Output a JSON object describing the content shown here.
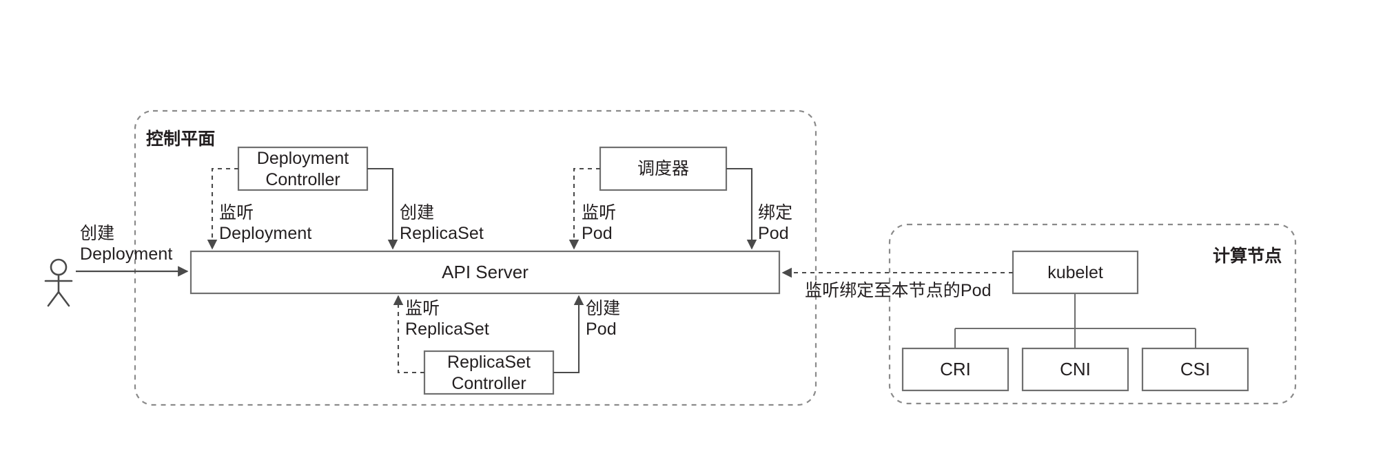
{
  "diagram": {
    "title": "Kubernetes control plane and compute node flow",
    "colors": {
      "stroke": "#6f6f6f",
      "boundary": "#8a8a8a",
      "text": "#231f20",
      "background": "#ffffff"
    }
  },
  "actor": {
    "name": "user-actor",
    "action_label_line1": "创建",
    "action_label_line2": "Deployment"
  },
  "control_plane": {
    "title": "控制平面",
    "api_server": {
      "label": "API Server"
    },
    "components": [
      {
        "id": "deployment-controller",
        "label_line1": "Deployment",
        "label_line2": "Controller"
      },
      {
        "id": "scheduler",
        "label_line1": "调度器",
        "label_line2": ""
      },
      {
        "id": "replicaset-controller",
        "label_line1": "ReplicaSet",
        "label_line2": "Controller"
      }
    ],
    "edges": [
      {
        "id": "watch-deployment",
        "style": "dashed",
        "line1": "监听",
        "line2": "Deployment"
      },
      {
        "id": "create-replicaset",
        "style": "solid",
        "line1": "创建",
        "line2": "ReplicaSet"
      },
      {
        "id": "watch-pod",
        "style": "dashed",
        "line1": "监听",
        "line2": "Pod"
      },
      {
        "id": "bind-pod",
        "style": "solid",
        "line1": "绑定",
        "line2": "Pod"
      },
      {
        "id": "watch-replicaset",
        "style": "dashed",
        "line1": "监听",
        "line2": "ReplicaSet"
      },
      {
        "id": "create-pod",
        "style": "solid",
        "line1": "创建",
        "line2": "Pod"
      }
    ]
  },
  "compute_node": {
    "title": "计算节点",
    "kubelet": {
      "label": "kubelet"
    },
    "plugins": [
      {
        "id": "cri",
        "label": "CRI"
      },
      {
        "id": "cni",
        "label": "CNI"
      },
      {
        "id": "csi",
        "label": "CSI"
      }
    ],
    "edges": [
      {
        "id": "watch-bound-pods",
        "style": "dashed",
        "label": "监听绑定至本节点的Pod"
      }
    ]
  }
}
